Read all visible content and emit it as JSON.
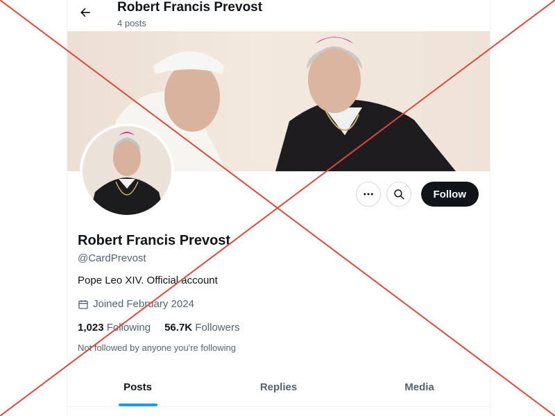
{
  "header": {
    "title": "Robert Francis Prevost",
    "post_count": "4 posts"
  },
  "profile": {
    "display_name": "Robert Francis Prevost",
    "handle": "@CardPrevost",
    "bio": "Pope Leo XIV. Official account",
    "joined": "Joined February 2024",
    "following_count": "1,023",
    "following_label": "Following",
    "followers_count": "56.7K",
    "followers_label": "Followers",
    "not_followed_note": "Not followed by anyone you're following"
  },
  "actions": {
    "more_icon": "more-icon",
    "search_icon": "search-icon",
    "follow_label": "Follow"
  },
  "tabs": [
    {
      "label": "Posts",
      "active": true
    },
    {
      "label": "Replies",
      "active": false
    },
    {
      "label": "Media",
      "active": false
    }
  ],
  "colors": {
    "accent": "#1d9bf0",
    "button_dark": "#0f1419",
    "overlay_cross": "#e0453f"
  }
}
